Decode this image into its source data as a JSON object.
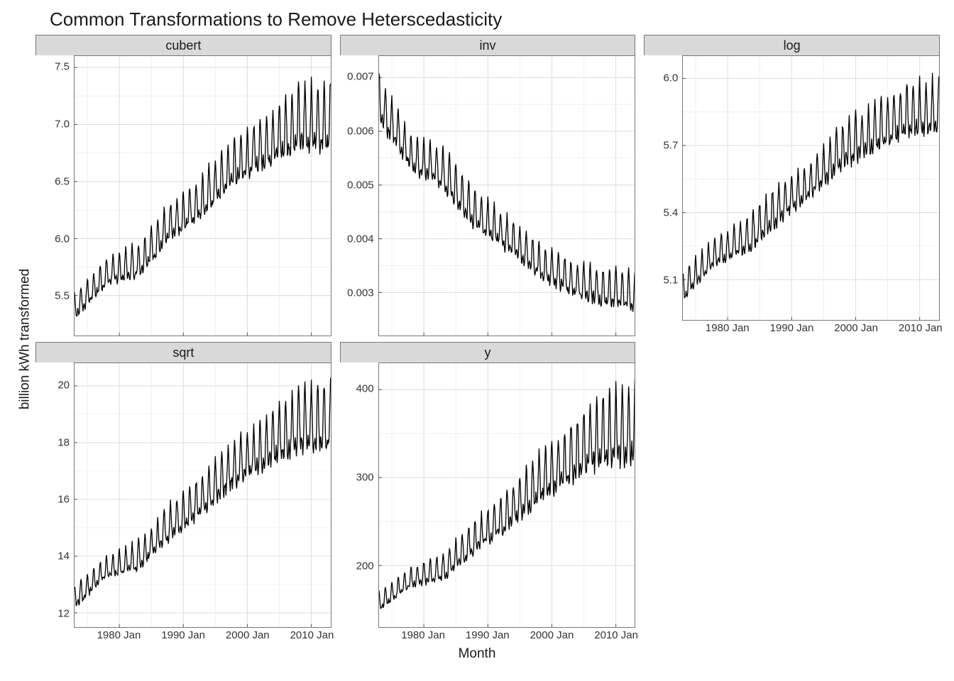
{
  "title": "Common Transformations to Remove Heterscedasticity",
  "xlabel": "Month",
  "ylabel": "billion kWh transformed",
  "x_range_years": [
    1973,
    2013
  ],
  "x_ticks": [
    {
      "year": 1980,
      "label": "1980 Jan"
    },
    {
      "year": 1990,
      "label": "1990 Jan"
    },
    {
      "year": 2000,
      "label": "2000 Jan"
    },
    {
      "year": 2010,
      "label": "2010 Jan"
    }
  ],
  "chart_data": [
    {
      "name": "cubert",
      "type": "line",
      "ylim": [
        5.15,
        7.6
      ],
      "yticks": [
        5.5,
        6.0,
        6.5,
        7.0,
        7.5
      ],
      "ytick_labels": [
        "5.5",
        "6.0",
        "6.5",
        "7.0",
        "7.5"
      ],
      "trend": [
        {
          "year": 1973,
          "lo": 5.2,
          "hi": 5.55
        },
        {
          "year": 1978,
          "lo": 5.5,
          "hi": 5.85
        },
        {
          "year": 1983,
          "lo": 5.55,
          "hi": 6.0
        },
        {
          "year": 1988,
          "lo": 5.85,
          "hi": 6.35
        },
        {
          "year": 1993,
          "lo": 6.05,
          "hi": 6.6
        },
        {
          "year": 1998,
          "lo": 6.3,
          "hi": 6.95
        },
        {
          "year": 2003,
          "lo": 6.45,
          "hi": 7.15
        },
        {
          "year": 2008,
          "lo": 6.55,
          "hi": 7.4
        },
        {
          "year": 2013,
          "lo": 6.55,
          "hi": 7.45
        }
      ],
      "has_x_axis": false
    },
    {
      "name": "inv",
      "type": "line",
      "ylim": [
        0.0022,
        0.0074
      ],
      "yticks": [
        0.003,
        0.004,
        0.005,
        0.006,
        0.007
      ],
      "ytick_labels": [
        "0.003",
        "0.004",
        "0.005",
        "0.006",
        "0.007"
      ],
      "trend": [
        {
          "year": 1973,
          "lo": 0.0058,
          "hi": 0.0072
        },
        {
          "year": 1978,
          "lo": 0.005,
          "hi": 0.006
        },
        {
          "year": 1983,
          "lo": 0.0046,
          "hi": 0.0058
        },
        {
          "year": 1988,
          "lo": 0.0039,
          "hi": 0.005
        },
        {
          "year": 1993,
          "lo": 0.0035,
          "hi": 0.0045
        },
        {
          "year": 1998,
          "lo": 0.003,
          "hi": 0.004
        },
        {
          "year": 2003,
          "lo": 0.0027,
          "hi": 0.0037
        },
        {
          "year": 2008,
          "lo": 0.0025,
          "hi": 0.0035
        },
        {
          "year": 2013,
          "lo": 0.0024,
          "hi": 0.0035
        }
      ],
      "has_x_axis": false
    },
    {
      "name": "log",
      "type": "line",
      "ylim": [
        4.92,
        6.1
      ],
      "yticks": [
        5.1,
        5.4,
        5.7,
        6.0
      ],
      "ytick_labels": [
        "5.1",
        "5.4",
        "5.7",
        "6.0"
      ],
      "trend": [
        {
          "year": 1973,
          "lo": 4.95,
          "hi": 5.15
        },
        {
          "year": 1978,
          "lo": 5.12,
          "hi": 5.3
        },
        {
          "year": 1983,
          "lo": 5.15,
          "hi": 5.4
        },
        {
          "year": 1988,
          "lo": 5.28,
          "hi": 5.55
        },
        {
          "year": 1993,
          "lo": 5.4,
          "hi": 5.65
        },
        {
          "year": 1998,
          "lo": 5.52,
          "hi": 5.82
        },
        {
          "year": 2003,
          "lo": 5.58,
          "hi": 5.92
        },
        {
          "year": 2008,
          "lo": 5.65,
          "hi": 6.0
        },
        {
          "year": 2013,
          "lo": 5.65,
          "hi": 6.03
        }
      ],
      "has_x_axis": true
    },
    {
      "name": "sqrt",
      "type": "line",
      "ylim": [
        11.5,
        20.8
      ],
      "yticks": [
        12,
        14,
        16,
        18,
        20
      ],
      "ytick_labels": [
        "12",
        "14",
        "16",
        "18",
        "20"
      ],
      "trend": [
        {
          "year": 1973,
          "lo": 11.8,
          "hi": 13.1
        },
        {
          "year": 1978,
          "lo": 12.9,
          "hi": 14.1
        },
        {
          "year": 1983,
          "lo": 13.1,
          "hi": 14.7
        },
        {
          "year": 1988,
          "lo": 14.1,
          "hi": 16.0
        },
        {
          "year": 1993,
          "lo": 14.9,
          "hi": 17.0
        },
        {
          "year": 1998,
          "lo": 15.8,
          "hi": 18.3
        },
        {
          "year": 2003,
          "lo": 16.4,
          "hi": 19.2
        },
        {
          "year": 2008,
          "lo": 16.8,
          "hi": 20.1
        },
        {
          "year": 2013,
          "lo": 16.8,
          "hi": 20.4
        }
      ],
      "has_x_axis": true
    },
    {
      "name": "y",
      "type": "line",
      "ylim": [
        130,
        430
      ],
      "yticks": [
        200,
        300,
        400
      ],
      "ytick_labels": [
        "200",
        "300",
        "400"
      ],
      "trend": [
        {
          "year": 1973,
          "lo": 140,
          "hi": 172
        },
        {
          "year": 1978,
          "lo": 167,
          "hi": 200
        },
        {
          "year": 1983,
          "lo": 170,
          "hi": 218
        },
        {
          "year": 1988,
          "lo": 200,
          "hi": 256
        },
        {
          "year": 1993,
          "lo": 222,
          "hi": 290
        },
        {
          "year": 1998,
          "lo": 250,
          "hi": 335
        },
        {
          "year": 2003,
          "lo": 268,
          "hi": 368
        },
        {
          "year": 2008,
          "lo": 282,
          "hi": 405
        },
        {
          "year": 2013,
          "lo": 282,
          "hi": 417
        }
      ],
      "has_x_axis": true
    }
  ]
}
